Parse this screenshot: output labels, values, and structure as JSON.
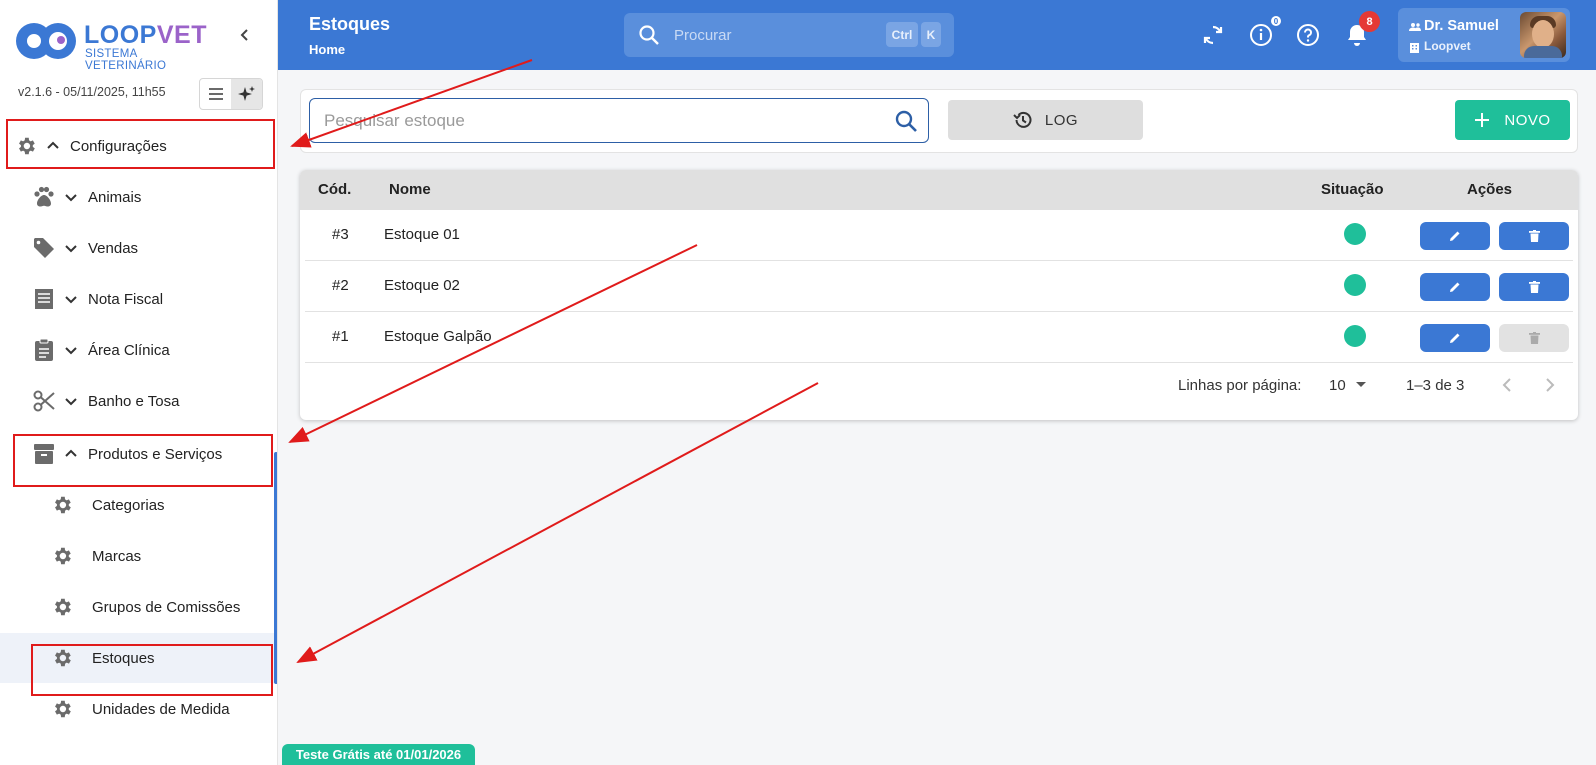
{
  "brand": {
    "name_part1": "LOOP",
    "name_part2": "VET",
    "subtitle": "SISTEMA VETERINÁRIO",
    "color_primary": "#3b78d4",
    "color_secondary": "#9b63c9"
  },
  "sidebar": {
    "version": "v2.1.6 - 05/11/2025, 11h55",
    "items": [
      {
        "label": "Configurações",
        "icon": "gear-icon",
        "expanded": true
      },
      {
        "label": "Animais",
        "icon": "paw-icon",
        "expanded": false
      },
      {
        "label": "Vendas",
        "icon": "tag-icon",
        "expanded": false
      },
      {
        "label": "Nota Fiscal",
        "icon": "receipt-icon",
        "expanded": false
      },
      {
        "label": "Área Clínica",
        "icon": "clipboard-icon",
        "expanded": false
      },
      {
        "label": "Banho e Tosa",
        "icon": "scissors-icon",
        "expanded": false
      },
      {
        "label": "Produtos e Serviços",
        "icon": "archive-box-icon",
        "expanded": true
      }
    ],
    "subitems": [
      {
        "label": "Categorias",
        "icon": "gear-icon"
      },
      {
        "label": "Marcas",
        "icon": "gear-icon"
      },
      {
        "label": "Grupos de Comissões",
        "icon": "gear-icon"
      },
      {
        "label": "Estoques",
        "icon": "gear-icon",
        "selected": true
      },
      {
        "label": "Unidades de Medida",
        "icon": "gear-icon"
      }
    ]
  },
  "header": {
    "title": "Estoques",
    "breadcrumb": "Home",
    "search_placeholder": "Procurar",
    "shortcut_key1": "Ctrl",
    "shortcut_key2": "K",
    "info_badge": "0",
    "notification_count": "8",
    "user_name": "Dr. Samuel",
    "user_org": "Loopvet",
    "color": "#3b78d4"
  },
  "toolbar": {
    "search_placeholder": "Pesquisar estoque",
    "log_label": "LOG",
    "new_label": "NOVO",
    "new_color": "#1fbf9a"
  },
  "table": {
    "columns": [
      "Cód.",
      "Nome",
      "Situação",
      "Ações"
    ],
    "rows": [
      {
        "cod": "#3",
        "nome": "Estoque 01",
        "active": true,
        "deletable": true
      },
      {
        "cod": "#2",
        "nome": "Estoque 02",
        "active": true,
        "deletable": true
      },
      {
        "cod": "#1",
        "nome": "Estoque Galpão",
        "active": true,
        "deletable": false
      }
    ],
    "pagination": {
      "rows_label": "Linhas por página:",
      "rows_per_page": "10",
      "range": "1–3 de 3"
    }
  },
  "trial_banner": "Teste Grátis até 01/01/2026",
  "annotation_color": "#e01b1b"
}
